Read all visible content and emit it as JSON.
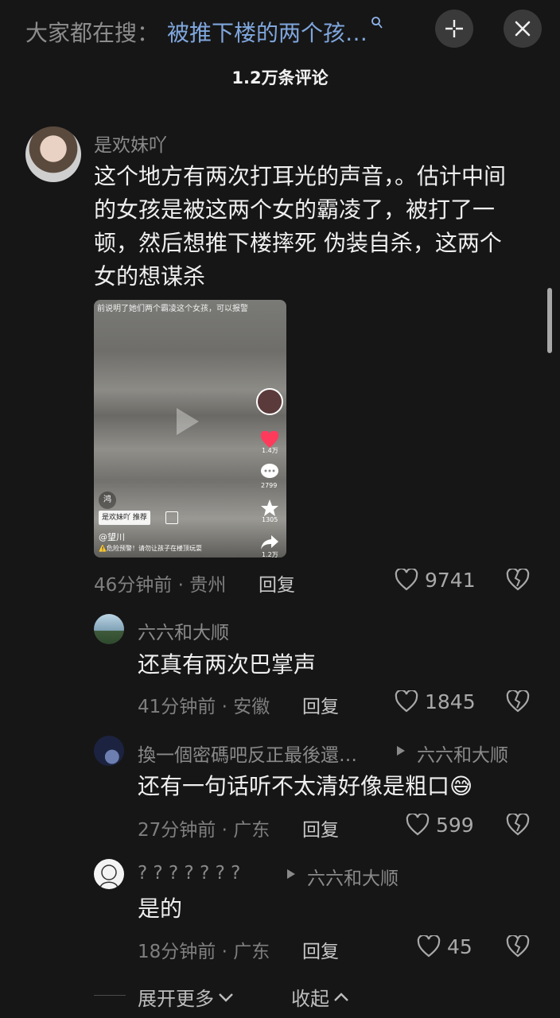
{
  "header": {
    "search_prefix": "大家都在搜：",
    "search_query": "被推下楼的两个孩…",
    "comment_count": "1.2万条评论"
  },
  "main_comment": {
    "username": "是欢妹吖",
    "content": "这个地方有两次打耳光的声音，。估计中间的女孩是被这两个女的霸凌了，被打了一顿，然后想推下楼摔死 伪装自杀，这两个女的想谋杀",
    "time_location": "46分钟前 · 贵州",
    "reply_label": "回复",
    "likes": "9741",
    "video": {
      "top_caption": "前说明了她们两个霸凌这个女孩，可以报警",
      "tag": "鸿",
      "recommend": "是欢妹吖 推荐",
      "author": "@望川",
      "warning": "⚠️危险预警！请勿让孩子在楼顶玩耍",
      "side_likes": "1.4万",
      "side_comments": "2799",
      "side_favorites": "1305",
      "side_shares": "1.2万"
    }
  },
  "replies": [
    {
      "username": "六六和大顺",
      "reply_to": "",
      "content": "还真有两次巴掌声",
      "time_location": "41分钟前 · 安徽",
      "reply_label": "回复",
      "likes": "1845"
    },
    {
      "username": "換一個密碼吧反正最後還…",
      "reply_to": "六六和大顺",
      "content": "还有一句话听不太清好像是粗口😅",
      "time_location": "27分钟前 · 广东",
      "reply_label": "回复",
      "likes": "599"
    },
    {
      "username": "? ? ? ? ? ? ?",
      "reply_to": "六六和大顺",
      "content": "是的",
      "time_location": "18分钟前 · 广东",
      "reply_label": "回复",
      "likes": "45"
    }
  ],
  "footer": {
    "expand_label": "展开更多",
    "collapse_label": "收起"
  },
  "colors": {
    "background": "#161616",
    "search_query": "#7fa6dd",
    "like_heart": "#ff3b5c"
  }
}
